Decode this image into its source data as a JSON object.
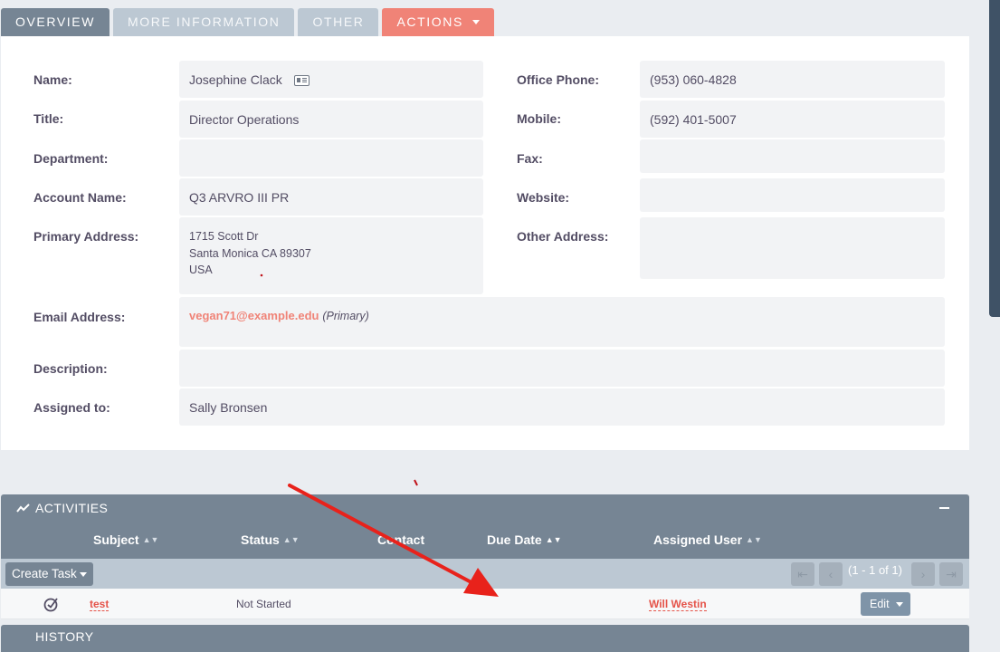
{
  "tabs": [
    {
      "label": "OVERVIEW"
    },
    {
      "label": "MORE INFORMATION"
    },
    {
      "label": "OTHER"
    },
    {
      "label": "ACTIONS"
    }
  ],
  "detail": {
    "name_label": "Name:",
    "name_value": "Josephine Clack",
    "title_label": "Title:",
    "title_value": "Director Operations",
    "department_label": "Department:",
    "department_value": "",
    "account_label": "Account Name:",
    "account_value": "Q3 ARVRO III PR",
    "primary_address_label": "Primary Address:",
    "primary_address_lines": [
      "1715 Scott Dr",
      "Santa Monica CA  89307",
      "USA"
    ],
    "office_phone_label": "Office Phone:",
    "office_phone_value": "(953) 060-4828",
    "mobile_label": "Mobile:",
    "mobile_value": "(592) 401-5007",
    "fax_label": "Fax:",
    "fax_value": "",
    "website_label": "Website:",
    "website_value": "",
    "other_address_label": "Other Address:",
    "other_address_value": "",
    "email_label": "Email Address:",
    "email_value": "vegan71@example.edu",
    "email_note": "(Primary)",
    "description_label": "Description:",
    "description_value": "",
    "assigned_label": "Assigned to:",
    "assigned_value": "Sally Bronsen"
  },
  "activities": {
    "title": "ACTIVITIES",
    "columns": [
      "Subject",
      "Status",
      "Contact",
      "Due Date",
      "Assigned User"
    ],
    "create_task_label": "Create Task",
    "pagination": "(1 - 1 of 1)",
    "rows": [
      {
        "subject": "test",
        "status": "Not Started",
        "contact": "",
        "due_date": "",
        "assigned_user": "Will Westin",
        "edit_label": "Edit"
      }
    ]
  },
  "history": {
    "title": "HISTORY"
  },
  "colors": {
    "accent": "#f08377",
    "tab_active": "#768594",
    "tab_inactive": "#bcc8d3",
    "link": "#e5544a",
    "annotation_arrow": "#e8221b"
  }
}
